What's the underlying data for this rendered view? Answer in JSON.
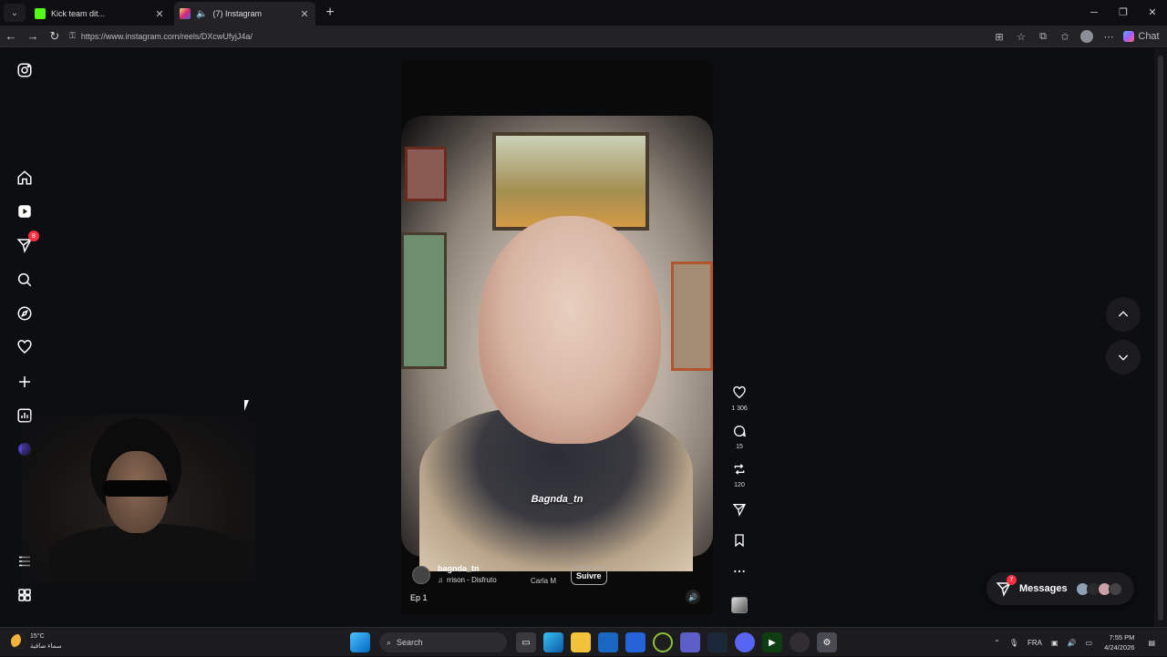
{
  "browser": {
    "tabs": [
      {
        "title": "Kick team dit...",
        "active": false,
        "favicon_color": "#53fc18"
      },
      {
        "title": "(7) Instagram",
        "active": true,
        "favicon_color": "#e1306c"
      }
    ],
    "url": "https://www.instagram.com/reels/DXcwUfyjJ4a/",
    "chat_label": "Chat"
  },
  "sidebar": {
    "notifications_badge": "8"
  },
  "reel": {
    "overlay_caption": "Bagnda_tn",
    "username": "bagnda_tn",
    "audio_text": "rrison - Disfruto",
    "audio_text2": "Carla M",
    "follow_label": "Suivre",
    "episode": "Ep 1"
  },
  "actions": {
    "likes": "1 306",
    "comments": "15",
    "reposts": "120"
  },
  "messages": {
    "label": "Messages",
    "badge": "7"
  },
  "taskbar": {
    "temperature": "15°C",
    "weather_desc": "سماء صافية",
    "search_placeholder": "Search",
    "language": "FRA",
    "time": "7:55 PM",
    "date": "4/24/2026"
  }
}
